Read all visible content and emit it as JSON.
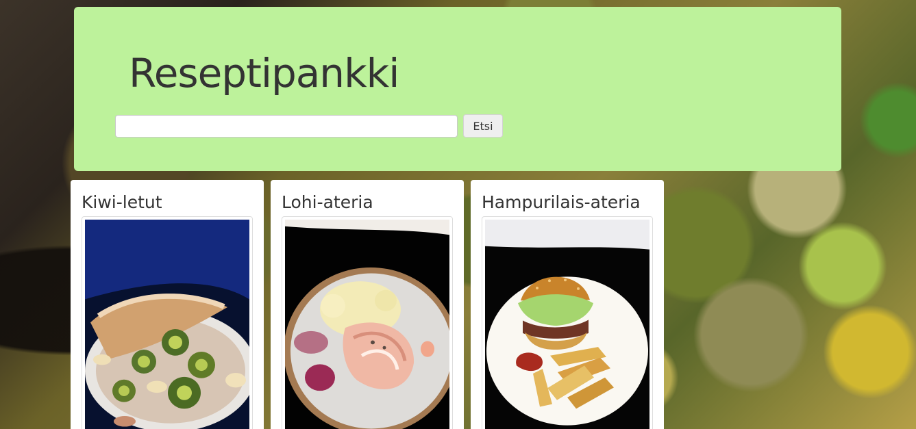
{
  "header": {
    "title": "Reseptipankki",
    "search": {
      "value": "",
      "placeholder": "",
      "button_label": "Etsi"
    }
  },
  "recipes": [
    {
      "title": "Kiwi-letut",
      "image": "kiwi-pancake-plate"
    },
    {
      "title": "Lohi-ateria",
      "image": "salmon-mash-plate"
    },
    {
      "title": "Hampurilais-ateria",
      "image": "burger-fries-plate"
    }
  ],
  "colors": {
    "header_background": "#bdf29b",
    "title_text": "#333333",
    "card_background": "#ffffff"
  }
}
